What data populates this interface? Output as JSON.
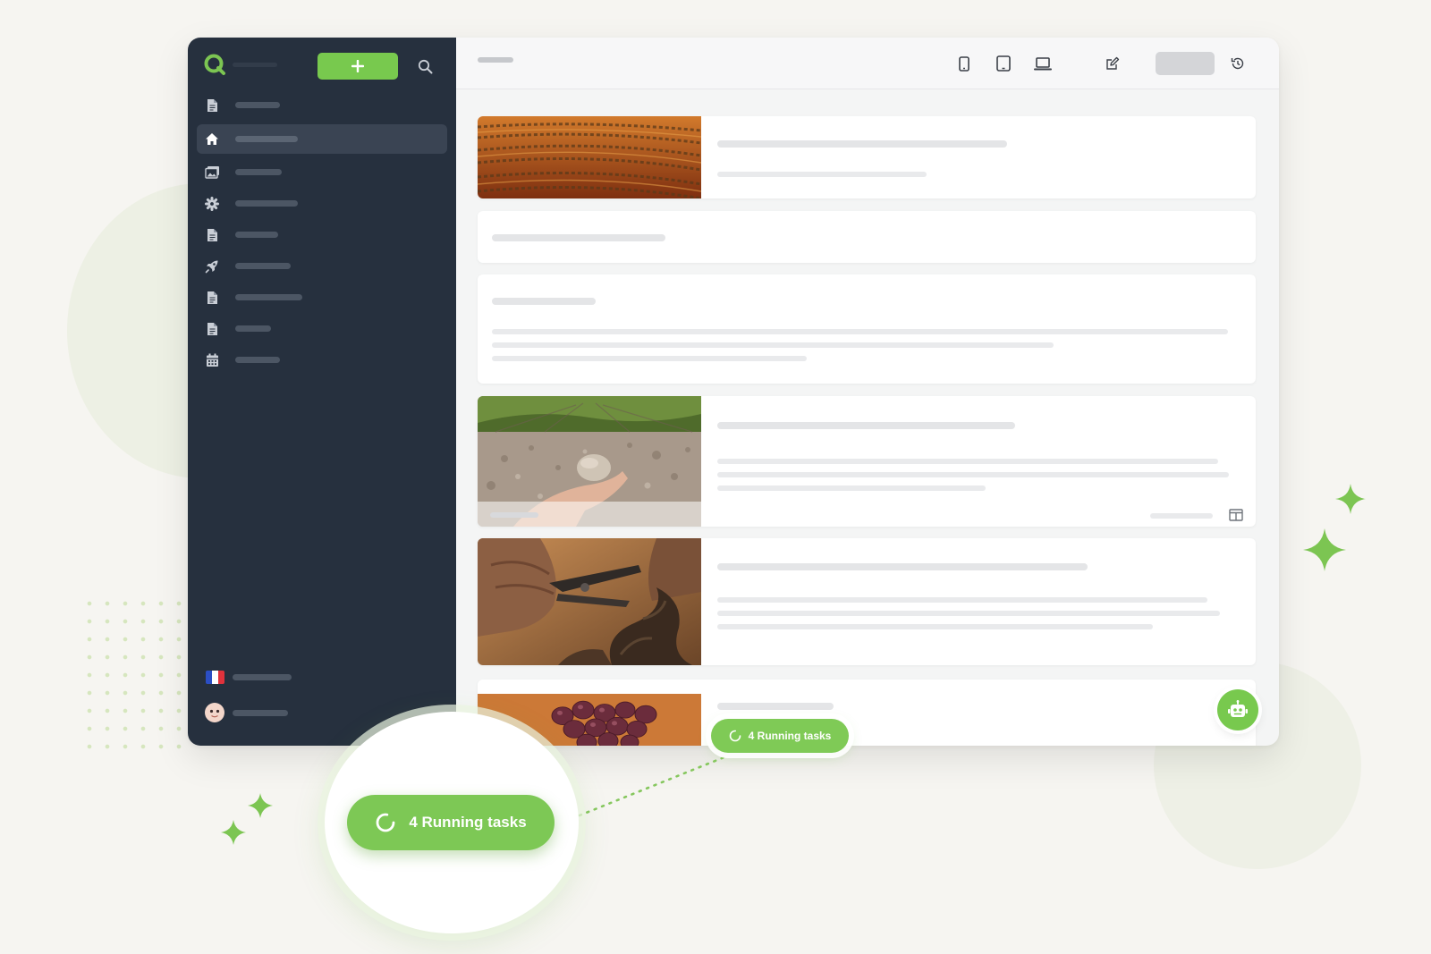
{
  "running_tasks": {
    "label": "4 Running tasks",
    "count": 4
  },
  "sidebar": {
    "items": [
      {
        "icon": "file-icon",
        "active": false
      },
      {
        "icon": "home-icon",
        "active": true
      },
      {
        "icon": "images-icon",
        "active": false
      },
      {
        "icon": "gear-icon",
        "active": false
      },
      {
        "icon": "file-icon",
        "active": false
      },
      {
        "icon": "rocket-icon",
        "active": false
      },
      {
        "icon": "file-icon",
        "active": false
      },
      {
        "icon": "file-icon",
        "active": false
      },
      {
        "icon": "calendar-icon",
        "active": false
      }
    ],
    "language_flag": "french-flag-icon",
    "user_avatar": "avatar-icon"
  },
  "topbar": {
    "device_icons": [
      "mobile-icon",
      "tablet-icon",
      "laptop-icon"
    ],
    "actions": [
      "edit-icon",
      "history-icon"
    ]
  },
  "content": {
    "cards": [
      {
        "type": "image-card",
        "image": "vineyard-rows"
      },
      {
        "type": "text-card"
      },
      {
        "type": "text-block"
      },
      {
        "type": "image-card",
        "image": "hand-holding-stone"
      },
      {
        "type": "image-card",
        "image": "pruning-vine"
      },
      {
        "type": "image-card",
        "image": "grapes"
      }
    ]
  },
  "colors": {
    "accent": "#78c94e",
    "sidebar_bg": "#26303e",
    "page_bg": "#f6f5f1"
  }
}
